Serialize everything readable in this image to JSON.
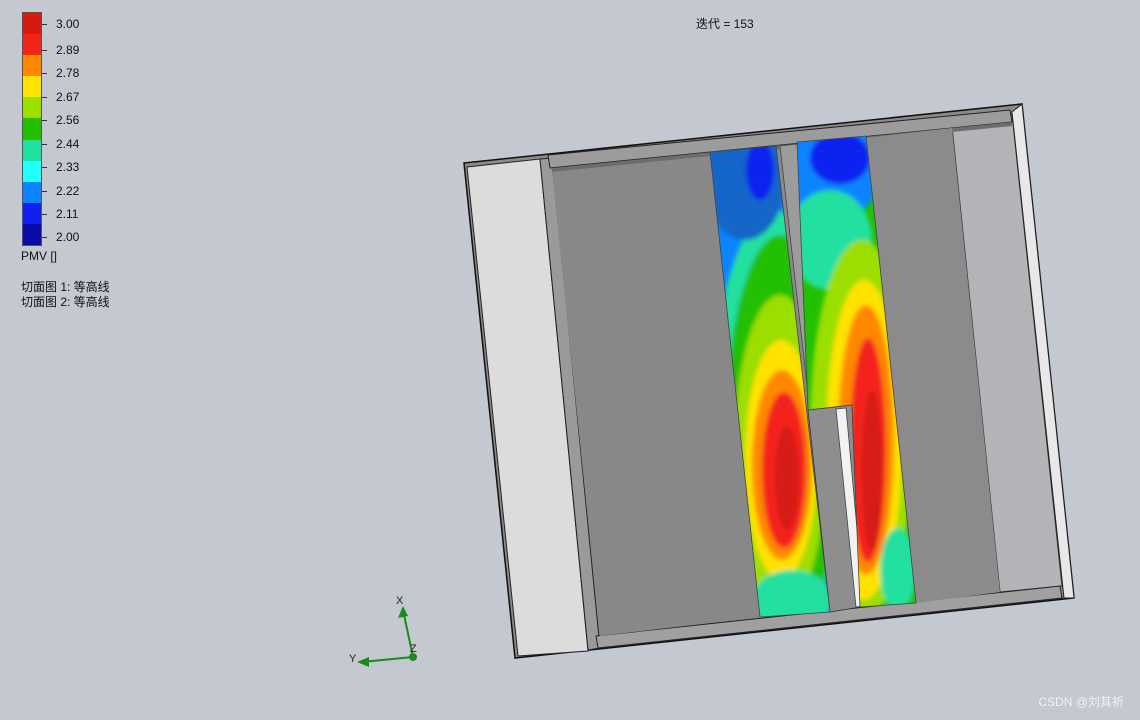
{
  "legend": {
    "title": "PMV []",
    "labels": [
      "3.00",
      "2.89",
      "2.78",
      "2.67",
      "2.56",
      "2.44",
      "2.33",
      "2.22",
      "2.11",
      "2.00"
    ],
    "colors": [
      "#d61a12",
      "#f4241a",
      "#ff8800",
      "#ffe200",
      "#9bde00",
      "#22c000",
      "#20e0a0",
      "#22ffff",
      "#0a84ff",
      "#1020f0",
      "#0a0aa8"
    ]
  },
  "iteration": "迭代 = 153",
  "cut_planes": [
    "切面图 1: 等高线",
    "切面图 2: 等高线"
  ],
  "triad": {
    "x": "X",
    "y": "Y",
    "z": "Z"
  },
  "watermark": "CSDN @刘其祈"
}
